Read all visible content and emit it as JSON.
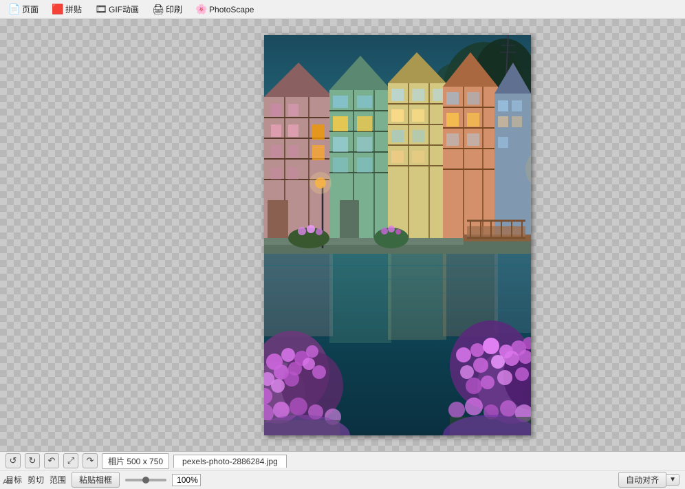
{
  "menu": {
    "items": [
      {
        "label": "页面",
        "icon": "📄"
      },
      {
        "label": "拼贴",
        "icon": "🟥"
      },
      {
        "label": "GIF动画",
        "icon": "🎞"
      },
      {
        "label": "印刷",
        "icon": "🖨"
      },
      {
        "label": "PhotoScape",
        "icon": "🌸"
      }
    ]
  },
  "toolbar": {
    "undo_icon": "↺",
    "redo_icon": "↻",
    "rotate_left_icon": "↶",
    "resize_icon": "⤢",
    "rotate_right_icon": "↷",
    "photo_info": "相片 500 x 750",
    "filename": "pexels-photo-2886284.jpg"
  },
  "bottom": {
    "target_label": "目标",
    "cut_label": "剪切",
    "range_label": "范围",
    "paste_frame_label": "粘贴相框",
    "zoom_value": "100%",
    "align_label": "自动对齐",
    "bottom_text": "Att"
  }
}
